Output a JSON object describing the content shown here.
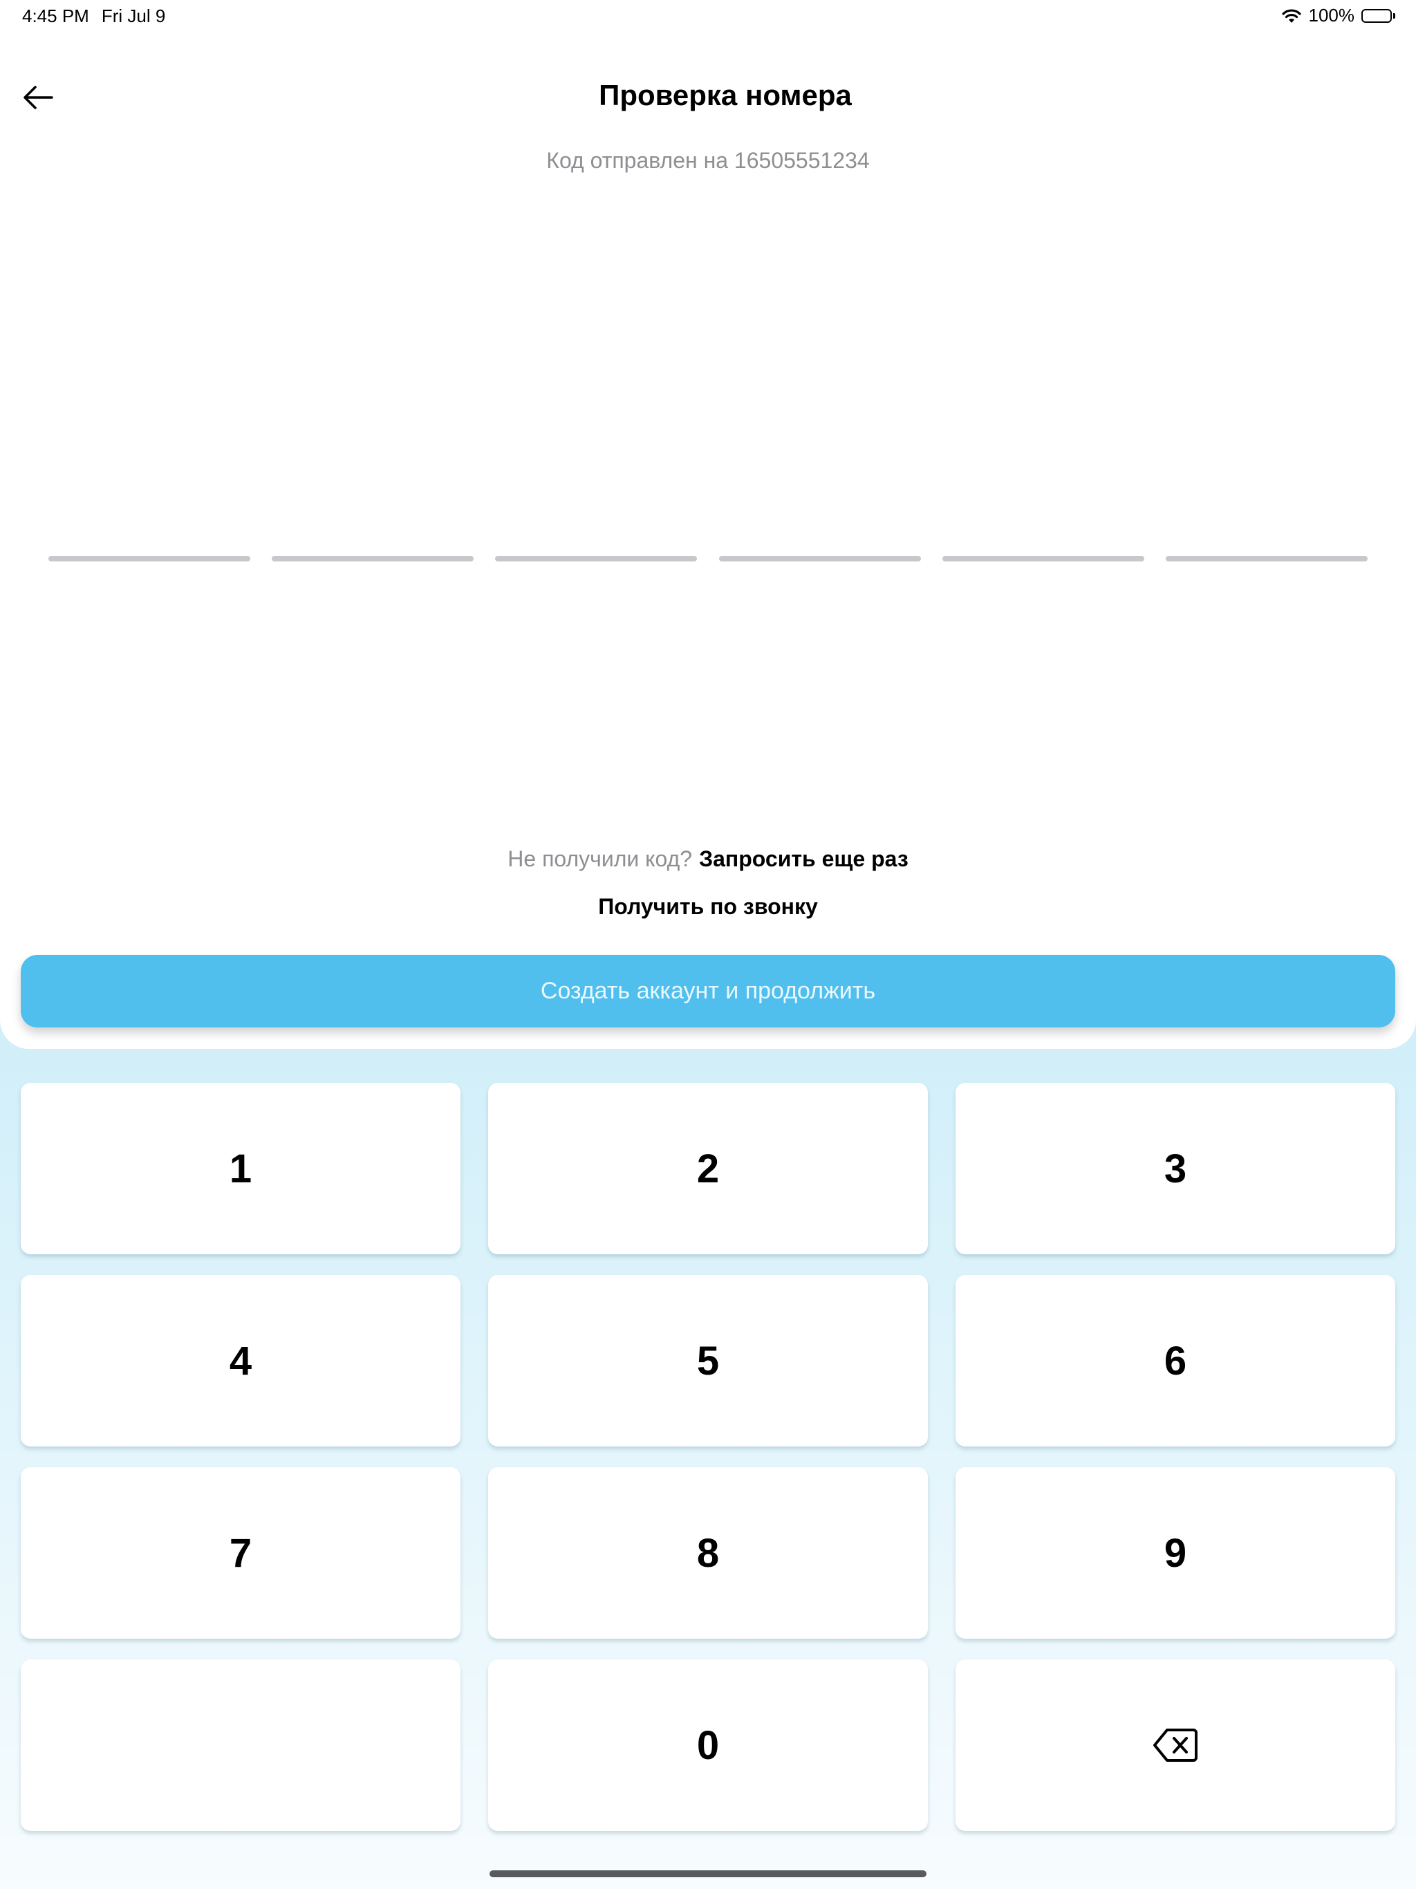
{
  "status_bar": {
    "time": "4:45 PM",
    "date": "Fri Jul 9",
    "battery": "100%",
    "battery_level": 1.0,
    "icons": [
      "wifi-icon",
      "battery-icon"
    ]
  },
  "header": {
    "back_icon": "arrow-left-icon",
    "title": "Проверка номера",
    "subtitle": "Код отправлен на 16505551234"
  },
  "code_input": {
    "slots": [
      "",
      "",
      "",
      "",
      "",
      ""
    ]
  },
  "resend": {
    "hint": "Не получили код?",
    "link": "Запросить еще раз",
    "call_link": "Получить по звонку"
  },
  "primary_button": {
    "label": "Создать аккаунт и продолжить",
    "color": "#50bfee"
  },
  "keypad": {
    "keys": [
      "1",
      "2",
      "3",
      "4",
      "5",
      "6",
      "7",
      "8",
      "9",
      "",
      "0",
      "backspace-icon"
    ]
  },
  "colors": {
    "accent": "#50bfee",
    "muted_text": "#8e8e93",
    "slot_line": "#c8c8cc"
  }
}
